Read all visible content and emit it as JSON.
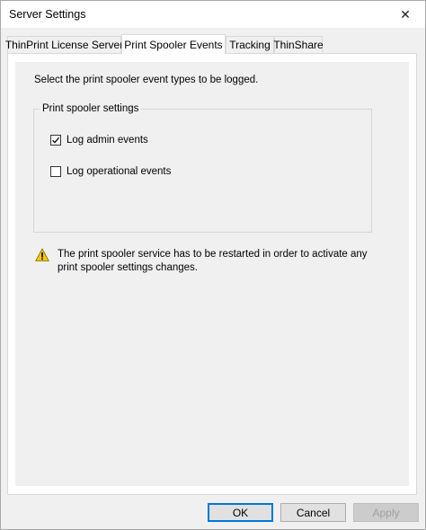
{
  "window": {
    "title": "Server Settings",
    "close_symbol": "✕"
  },
  "tabs": [
    {
      "label": "ThinPrint License Server",
      "active": false
    },
    {
      "label": "Print Spooler Events",
      "active": true
    },
    {
      "label": "Tracking",
      "active": false
    },
    {
      "label": "ThinShare",
      "active": false
    }
  ],
  "content": {
    "intro": "Select the print spooler event types to be logged.",
    "group_title": "Print spooler settings",
    "checkboxes": [
      {
        "label": "Log admin events",
        "checked": true
      },
      {
        "label": "Log operational events",
        "checked": false
      }
    ],
    "warning": {
      "icon": "warning-icon",
      "text": "The print spooler service has to be restarted in order to activate any print spooler settings changes."
    }
  },
  "buttons": {
    "ok": "OK",
    "cancel": "Cancel",
    "apply": "Apply"
  },
  "colors": {
    "accent": "#0078d7",
    "warning": "#f2c811"
  }
}
